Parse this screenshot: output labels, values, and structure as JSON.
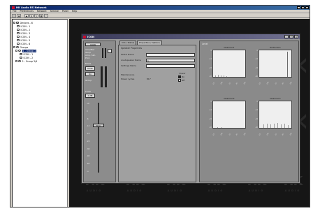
{
  "app": {
    "title": "HK Audio RS Network",
    "window_buttons": [
      "_",
      "□",
      "×"
    ]
  },
  "menu": [
    "File",
    "Preferences",
    "Network",
    "Service",
    "Panel",
    "Help"
  ],
  "toolbar_buttons": [
    "open-icon",
    "save-icon",
    "network-icon",
    "connect-icon",
    "refresh-icon",
    "grid-icon",
    "window-icon"
  ],
  "tree": {
    "devices_label": "Devices - 6",
    "devices": [
      "ICON - 1",
      "ICON - 2",
      "ICON - 3",
      "ICON - 4",
      "ICON - 5",
      "ICON - 6"
    ],
    "groups_label": "Groups",
    "group1_label": "1 - Group 1",
    "group1_items": [
      "ICON - 1",
      "ICON - 2"
    ],
    "group2_label": "2 - Group 3/4"
  },
  "workspace": {
    "logo_text": "HK",
    "logo_sub": "AUDIO"
  },
  "child": {
    "title": "ICON",
    "buttons": [
      "_",
      "□",
      "×"
    ],
    "tabs": [
      "Info / Status",
      "Properties / Options"
    ],
    "left_panel": {
      "labels": [
        "Amplifier",
        "Temp",
        "Amp. Sat.",
        "Prot."
      ],
      "mode_label": "Mode",
      "mute_label": "Mute",
      "on_label": "On",
      "group_label": "Group",
      "level_label": "Level",
      "level_value": "0 dB",
      "fader_label": "Trim",
      "fader_ticks": [
        "+6",
        "0",
        "-6",
        "-12",
        "-18",
        "-24",
        "-30",
        "-40",
        "-60",
        "-∞"
      ]
    },
    "props": {
      "header": "Speaker Properties",
      "rows": [
        {
          "label": "Model Name",
          "value": ""
        },
        {
          "label": "Loudspeaker Name",
          "value": "1"
        },
        {
          "label": "Settings Name",
          "value": ""
        }
      ],
      "maintenance_label": "Maintenance",
      "power_cycles_label": "Power cycles",
      "power_cycles_value": "817",
      "power_label": "Power",
      "power_on": "On",
      "power_off": "Off"
    },
    "graphs": {
      "header": "Level",
      "titles": [
        "Channel 1",
        "Protection",
        "Channel 2",
        "Channel 3"
      ],
      "y_ticks": [
        "0",
        "-6",
        "-12",
        "-18",
        "-24",
        "-30",
        "-40"
      ],
      "x_ticks": [
        "63",
        "125",
        "250",
        "500",
        "1k",
        "2k",
        "4k",
        "8k",
        "16k"
      ]
    }
  }
}
